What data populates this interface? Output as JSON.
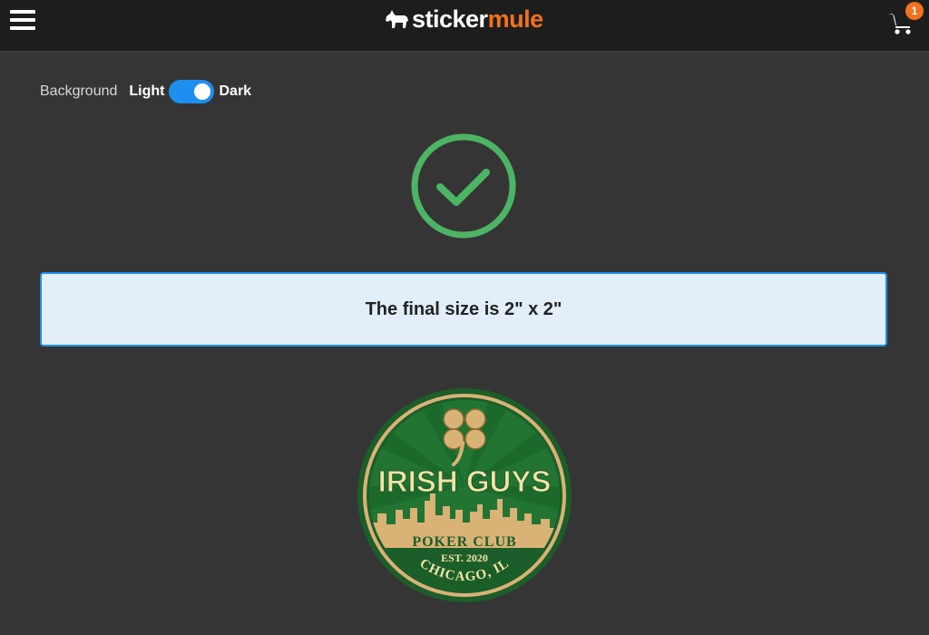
{
  "header": {
    "logo_part1": "sticker",
    "logo_part2": "mule",
    "cart_count": "1",
    "menu_icon": "hamburger-icon",
    "cart_icon": "shopping-cart-icon"
  },
  "background": {
    "label": "Background",
    "option_light": "Light",
    "option_dark": "Dark",
    "selected": "Dark"
  },
  "status": {
    "icon": "check-circle-icon",
    "message": "The final size is 2\" x 2\""
  },
  "sticker": {
    "title": "IRISH GUYS",
    "subtitle": "POKER CLUB",
    "established": "EST. 2020",
    "location": "CHICAGO, IL"
  },
  "colors": {
    "accent_blue": "#1e8ff0",
    "brand_orange": "#f2711c",
    "success_green": "#4cb563",
    "sticker_green": "#1f6b2e",
    "sticker_gold": "#d9b276"
  }
}
